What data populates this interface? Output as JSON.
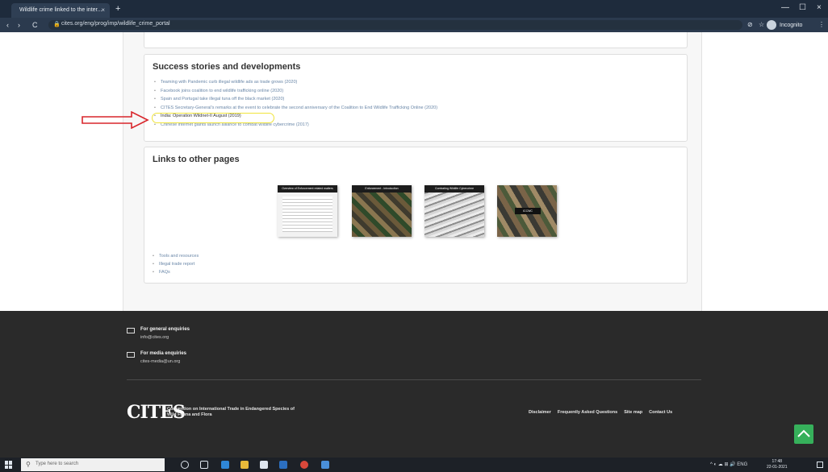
{
  "browser": {
    "tab_title": "Wildlife crime linked to the inter...",
    "tab_close": "×",
    "new_tab": "+",
    "url": "cites.org/eng/prog/imp/wildlife_crime_portal",
    "profile_label": "Incognito",
    "controls": {
      "minimize": "—",
      "maximize": "☐",
      "close": "×"
    },
    "nav": {
      "back": "‹",
      "forward": "›",
      "reload": "C"
    }
  },
  "success": {
    "title": "Success stories and developments",
    "items": [
      "Teaming with Pandemic curb illegal wildlife ads as trade grows (2020)",
      "Facebook joins coalition to end wildlife trafficking online (2020)",
      "Spain and Portugal take illegal tuna off the black market (2020)",
      "CITES Secretary-General's remarks at the event to celebrate the second anniversary of the Coalition to End Wildlife Trafficking Online (2020)",
      "India: Operation Wildnet-II August (2019)",
      "Chinese internet giants launch alliance to combat wildlife cybercrime (2017)"
    ]
  },
  "links": {
    "title": "Links to other pages",
    "thumbs": [
      {
        "caption": "Overview of Enforcement related matters"
      },
      {
        "caption": "Enforcement - Introduction"
      },
      {
        "caption": "Combating Wildlife Cybercrime"
      },
      {
        "caption": "ICCWC"
      }
    ],
    "items": [
      "Tools and resources",
      "Illegal trade report",
      "FAQs"
    ]
  },
  "footer": {
    "general_label": "For general enquiries",
    "general_email": "info@cites.org",
    "media_label": "For media enquiries",
    "media_email": "cites-media@un.org",
    "logo_text": "CITES",
    "org_name": "Convention on International Trade in Endangered Species of Wild Fauna and Flora",
    "nav_links": [
      "Disclaimer",
      "Frequently Asked Questions",
      "Site map",
      "Contact Us"
    ]
  },
  "taskbar": {
    "search_placeholder": "Type here to search",
    "tray_text": "^ ◐ ☁ ⊞ 🔊 ENG",
    "clock_time": "17:48",
    "clock_date": "22-01-2021"
  },
  "colors": {
    "highlight_ring": "#f0e43b",
    "arrow_red": "#d9262c",
    "footer_bg": "#2a2a2a",
    "back_to_top": "#36b05b",
    "link_blue": "#6a87a8"
  }
}
